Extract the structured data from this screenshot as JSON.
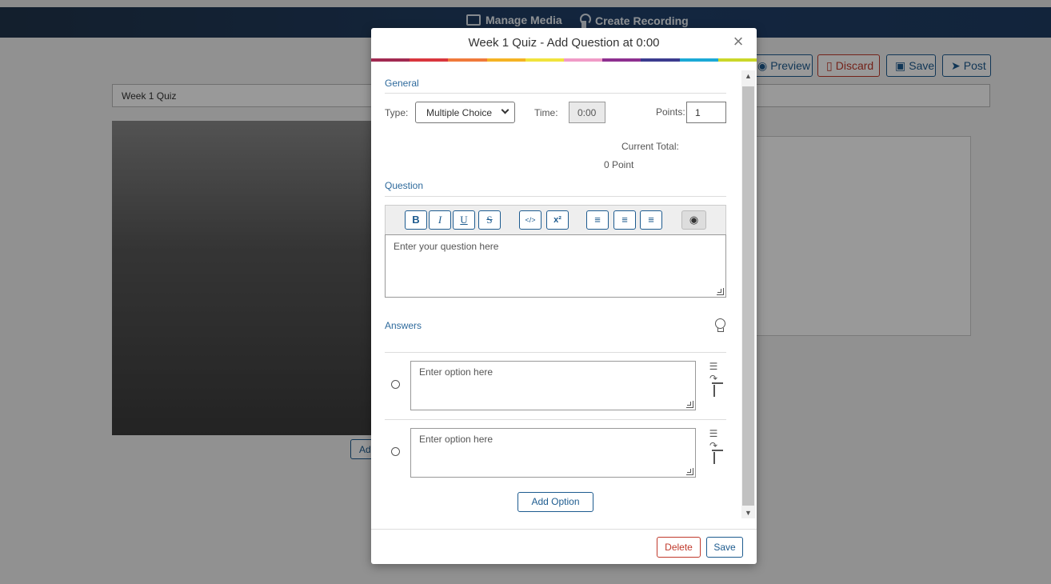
{
  "header": {
    "manage_media": "Manage Media",
    "create_recording": "Create Recording"
  },
  "background": {
    "preview": "Preview",
    "discard": "Discard",
    "save": "Save",
    "post": "Post",
    "quiz_title": "Week 1 Quiz",
    "add_partial": "Ad"
  },
  "modal": {
    "title": "Week 1 Quiz - Add Question at 0:00",
    "close": "×",
    "rainbow": [
      "#a22a52",
      "#d9363e",
      "#f07a3b",
      "#f5b324",
      "#f1e33c",
      "#f09bc7",
      "#8e2f90",
      "#3b3b8f",
      "#1ba9d6",
      "#cbd72a"
    ],
    "general": {
      "title": "General",
      "type_label": "Type:",
      "type_value": "Multiple Choice",
      "time_label": "Time:",
      "time_value": "0:00",
      "points_label": "Points:",
      "points_value": "1",
      "current_total_label": "Current Total:",
      "current_total_value": "0 Point"
    },
    "question": {
      "title": "Question",
      "placeholder": "Enter your question here",
      "toolbar": {
        "bold": "B",
        "italic": "I",
        "underline": "U",
        "strike": "S",
        "code": "</>",
        "superscript": "x²",
        "bullet": "≡",
        "numbered": "≡",
        "indent": "≡",
        "preview": "◉"
      }
    },
    "answers": {
      "title": "Answers",
      "options": [
        {
          "placeholder": "Enter option here"
        },
        {
          "placeholder": "Enter option here"
        }
      ],
      "add_option": "Add Option"
    },
    "footer": {
      "delete": "Delete",
      "save": "Save"
    }
  }
}
